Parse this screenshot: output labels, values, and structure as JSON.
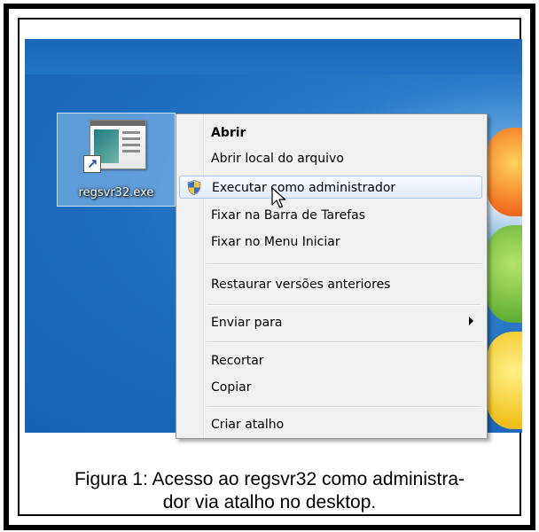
{
  "desktop_icon": {
    "label": "regsvr32.exe",
    "icon": "application-shortcut-icon"
  },
  "context_menu": {
    "items": [
      {
        "label": "Abrir",
        "bold": true
      },
      {
        "label": "Abrir local do arquivo"
      },
      {
        "label": "Executar como administrador",
        "icon": "uac-shield-icon",
        "highlighted": true
      },
      {
        "label": "Fixar na Barra de Tarefas"
      },
      {
        "label": "Fixar no Menu Iniciar"
      },
      {
        "label": "Restaurar versões anteriores"
      },
      {
        "label": "Enviar para",
        "submenu": true
      },
      {
        "label": "Recortar"
      },
      {
        "label": "Copiar"
      },
      {
        "label": "Criar atalho"
      }
    ]
  },
  "caption": {
    "line1": "Figura 1: Acesso ao regsvr32 como administra-",
    "line2": "dor via atalho no desktop."
  },
  "colors": {
    "desktop_blue": "#1e6cbc",
    "menu_bg": "#f0f0f0",
    "highlight_border": "#a8c8ec"
  }
}
